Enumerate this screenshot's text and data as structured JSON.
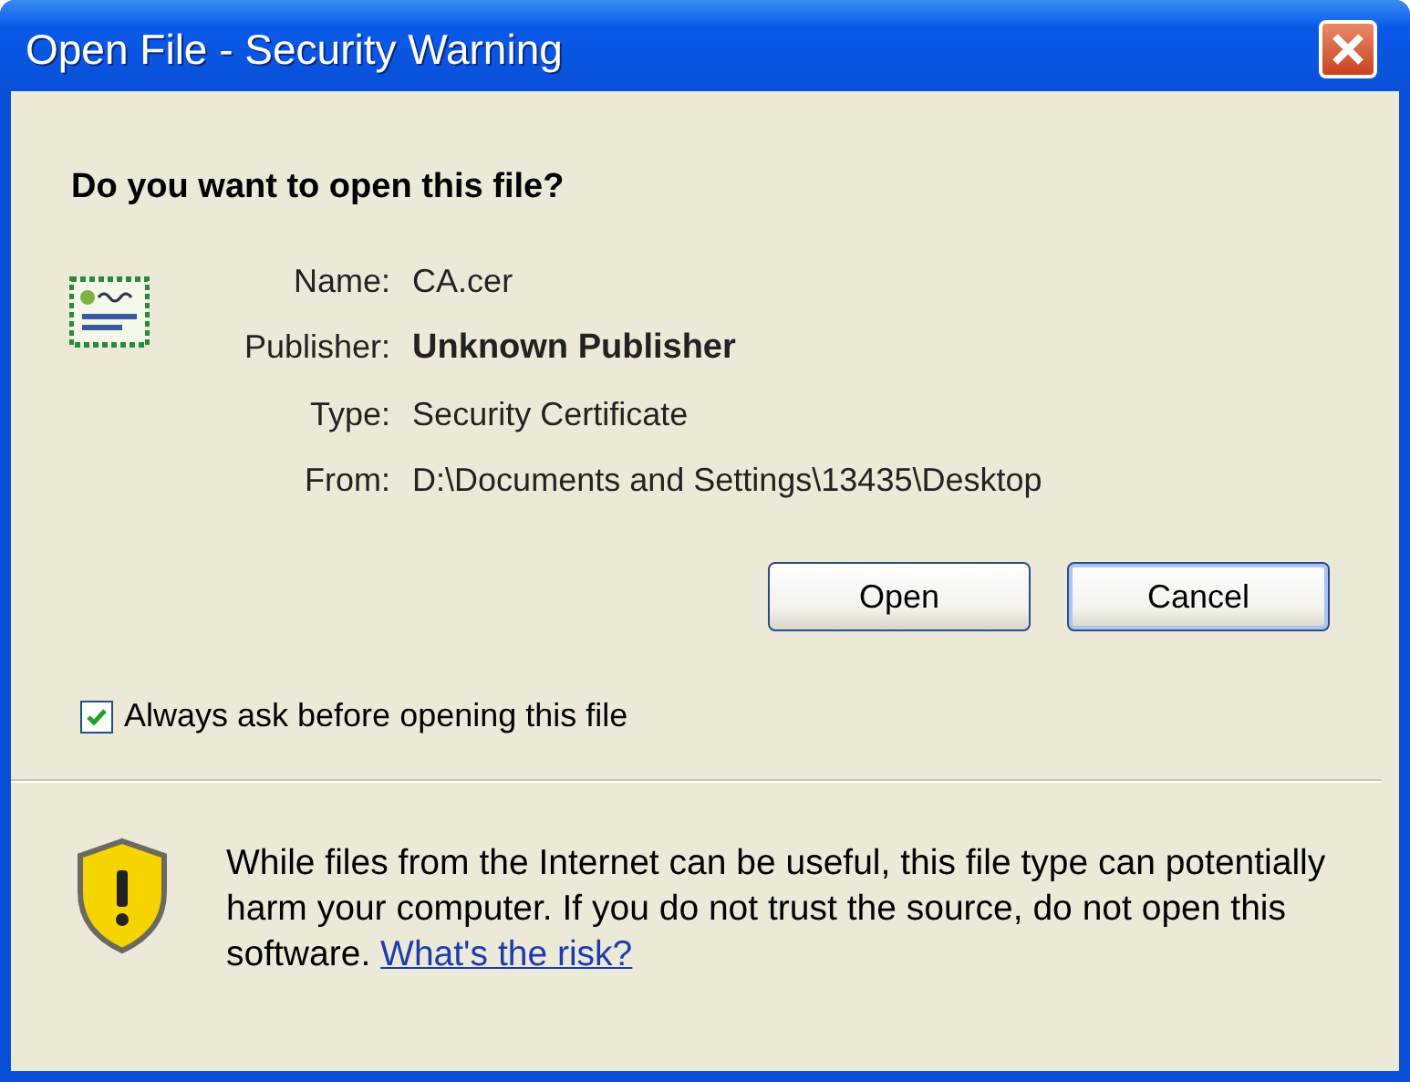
{
  "window": {
    "title": "Open File - Security Warning"
  },
  "question": "Do you want to open this file?",
  "details": [
    {
      "label": "Name:",
      "value": "CA.cer",
      "bold": false
    },
    {
      "label": "Publisher:",
      "value": "Unknown Publisher",
      "bold": true
    },
    {
      "label": "Type:",
      "value": "Security Certificate",
      "bold": false
    },
    {
      "label": "From:",
      "value": "D:\\Documents and Settings\\13435\\Desktop",
      "bold": false
    }
  ],
  "buttons": [
    {
      "label": "Open",
      "kind": "open"
    },
    {
      "label": "Cancel",
      "kind": "cancel"
    }
  ],
  "checkbox": {
    "label": "Always ask before opening this file",
    "checked": true
  },
  "warning": {
    "text": "While files from the Internet can be useful, this file type can potentially harm your computer. If you do not trust the source, do not open this software.",
    "link": "What's the risk?"
  }
}
